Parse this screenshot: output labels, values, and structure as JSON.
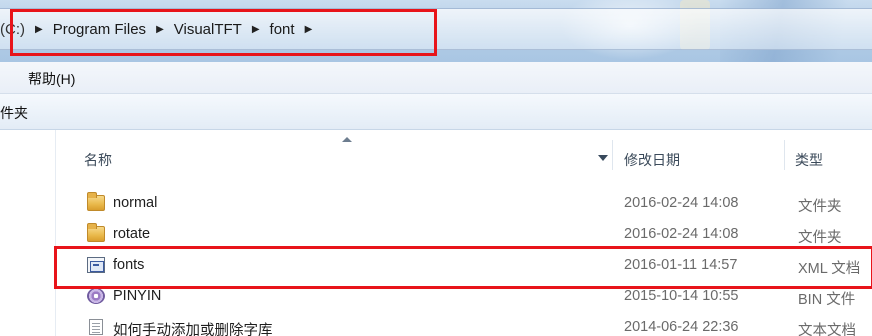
{
  "address_bar": {
    "drive_fragment": "(C:)",
    "crumbs": [
      "Program Files",
      "VisualTFT",
      "font"
    ],
    "separator": "▶"
  },
  "menu": {
    "help": "帮助(H)"
  },
  "toolbar": {
    "new_folder_fragment": "件夹"
  },
  "columns": {
    "name": "名称",
    "date_modified": "修改日期",
    "type": "类型"
  },
  "files": [
    {
      "name": "normal",
      "date": "2016-02-24 14:08",
      "type": "文件夹",
      "icon": "folder-icon"
    },
    {
      "name": "rotate",
      "date": "2016-02-24 14:08",
      "type": "文件夹",
      "icon": "folder-icon"
    },
    {
      "name": "fonts",
      "date": "2016-01-11 14:57",
      "type": "XML 文档",
      "icon": "xml-file-icon"
    },
    {
      "name": "PINYIN",
      "date": "2015-10-14 10:55",
      "type": "BIN 文件",
      "icon": "bin-file-icon"
    },
    {
      "name": "如何手动添加或删除字库",
      "date": "2014-06-24 22:36",
      "type": "文本文档",
      "icon": "text-file-icon"
    }
  ],
  "colors": {
    "highlight": "#e8141a",
    "titlebar": "#b4cde6"
  }
}
